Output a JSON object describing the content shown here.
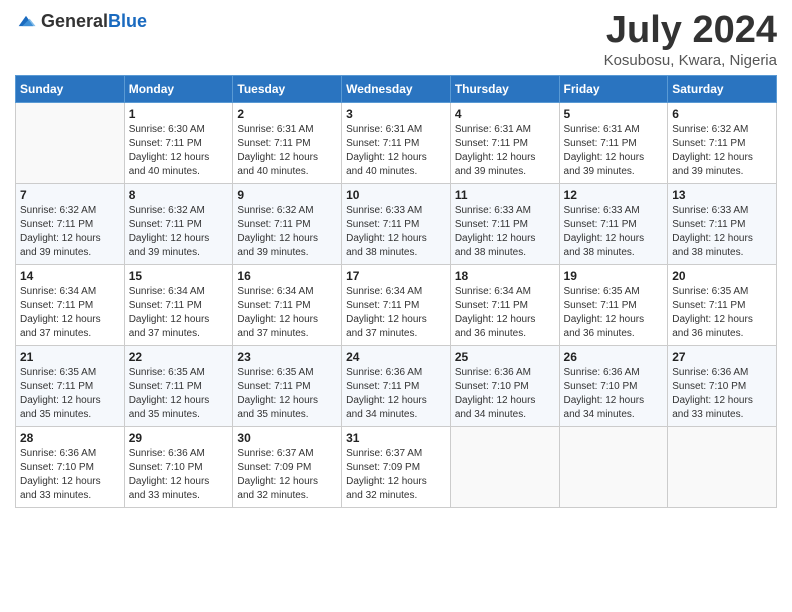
{
  "header": {
    "logo_general": "General",
    "logo_blue": "Blue",
    "title": "July 2024",
    "subtitle": "Kosubosu, Kwara, Nigeria"
  },
  "calendar": {
    "days_of_week": [
      "Sunday",
      "Monday",
      "Tuesday",
      "Wednesday",
      "Thursday",
      "Friday",
      "Saturday"
    ],
    "weeks": [
      [
        {
          "day": "",
          "detail": ""
        },
        {
          "day": "1",
          "detail": "Sunrise: 6:30 AM\nSunset: 7:11 PM\nDaylight: 12 hours\nand 40 minutes."
        },
        {
          "day": "2",
          "detail": "Sunrise: 6:31 AM\nSunset: 7:11 PM\nDaylight: 12 hours\nand 40 minutes."
        },
        {
          "day": "3",
          "detail": "Sunrise: 6:31 AM\nSunset: 7:11 PM\nDaylight: 12 hours\nand 40 minutes."
        },
        {
          "day": "4",
          "detail": "Sunrise: 6:31 AM\nSunset: 7:11 PM\nDaylight: 12 hours\nand 39 minutes."
        },
        {
          "day": "5",
          "detail": "Sunrise: 6:31 AM\nSunset: 7:11 PM\nDaylight: 12 hours\nand 39 minutes."
        },
        {
          "day": "6",
          "detail": "Sunrise: 6:32 AM\nSunset: 7:11 PM\nDaylight: 12 hours\nand 39 minutes."
        }
      ],
      [
        {
          "day": "7",
          "detail": "Sunrise: 6:32 AM\nSunset: 7:11 PM\nDaylight: 12 hours\nand 39 minutes."
        },
        {
          "day": "8",
          "detail": "Sunrise: 6:32 AM\nSunset: 7:11 PM\nDaylight: 12 hours\nand 39 minutes."
        },
        {
          "day": "9",
          "detail": "Sunrise: 6:32 AM\nSunset: 7:11 PM\nDaylight: 12 hours\nand 39 minutes."
        },
        {
          "day": "10",
          "detail": "Sunrise: 6:33 AM\nSunset: 7:11 PM\nDaylight: 12 hours\nand 38 minutes."
        },
        {
          "day": "11",
          "detail": "Sunrise: 6:33 AM\nSunset: 7:11 PM\nDaylight: 12 hours\nand 38 minutes."
        },
        {
          "day": "12",
          "detail": "Sunrise: 6:33 AM\nSunset: 7:11 PM\nDaylight: 12 hours\nand 38 minutes."
        },
        {
          "day": "13",
          "detail": "Sunrise: 6:33 AM\nSunset: 7:11 PM\nDaylight: 12 hours\nand 38 minutes."
        }
      ],
      [
        {
          "day": "14",
          "detail": "Sunrise: 6:34 AM\nSunset: 7:11 PM\nDaylight: 12 hours\nand 37 minutes."
        },
        {
          "day": "15",
          "detail": "Sunrise: 6:34 AM\nSunset: 7:11 PM\nDaylight: 12 hours\nand 37 minutes."
        },
        {
          "day": "16",
          "detail": "Sunrise: 6:34 AM\nSunset: 7:11 PM\nDaylight: 12 hours\nand 37 minutes."
        },
        {
          "day": "17",
          "detail": "Sunrise: 6:34 AM\nSunset: 7:11 PM\nDaylight: 12 hours\nand 37 minutes."
        },
        {
          "day": "18",
          "detail": "Sunrise: 6:34 AM\nSunset: 7:11 PM\nDaylight: 12 hours\nand 36 minutes."
        },
        {
          "day": "19",
          "detail": "Sunrise: 6:35 AM\nSunset: 7:11 PM\nDaylight: 12 hours\nand 36 minutes."
        },
        {
          "day": "20",
          "detail": "Sunrise: 6:35 AM\nSunset: 7:11 PM\nDaylight: 12 hours\nand 36 minutes."
        }
      ],
      [
        {
          "day": "21",
          "detail": "Sunrise: 6:35 AM\nSunset: 7:11 PM\nDaylight: 12 hours\nand 35 minutes."
        },
        {
          "day": "22",
          "detail": "Sunrise: 6:35 AM\nSunset: 7:11 PM\nDaylight: 12 hours\nand 35 minutes."
        },
        {
          "day": "23",
          "detail": "Sunrise: 6:35 AM\nSunset: 7:11 PM\nDaylight: 12 hours\nand 35 minutes."
        },
        {
          "day": "24",
          "detail": "Sunrise: 6:36 AM\nSunset: 7:11 PM\nDaylight: 12 hours\nand 34 minutes."
        },
        {
          "day": "25",
          "detail": "Sunrise: 6:36 AM\nSunset: 7:10 PM\nDaylight: 12 hours\nand 34 minutes."
        },
        {
          "day": "26",
          "detail": "Sunrise: 6:36 AM\nSunset: 7:10 PM\nDaylight: 12 hours\nand 34 minutes."
        },
        {
          "day": "27",
          "detail": "Sunrise: 6:36 AM\nSunset: 7:10 PM\nDaylight: 12 hours\nand 33 minutes."
        }
      ],
      [
        {
          "day": "28",
          "detail": "Sunrise: 6:36 AM\nSunset: 7:10 PM\nDaylight: 12 hours\nand 33 minutes."
        },
        {
          "day": "29",
          "detail": "Sunrise: 6:36 AM\nSunset: 7:10 PM\nDaylight: 12 hours\nand 33 minutes."
        },
        {
          "day": "30",
          "detail": "Sunrise: 6:37 AM\nSunset: 7:09 PM\nDaylight: 12 hours\nand 32 minutes."
        },
        {
          "day": "31",
          "detail": "Sunrise: 6:37 AM\nSunset: 7:09 PM\nDaylight: 12 hours\nand 32 minutes."
        },
        {
          "day": "",
          "detail": ""
        },
        {
          "day": "",
          "detail": ""
        },
        {
          "day": "",
          "detail": ""
        }
      ]
    ]
  }
}
